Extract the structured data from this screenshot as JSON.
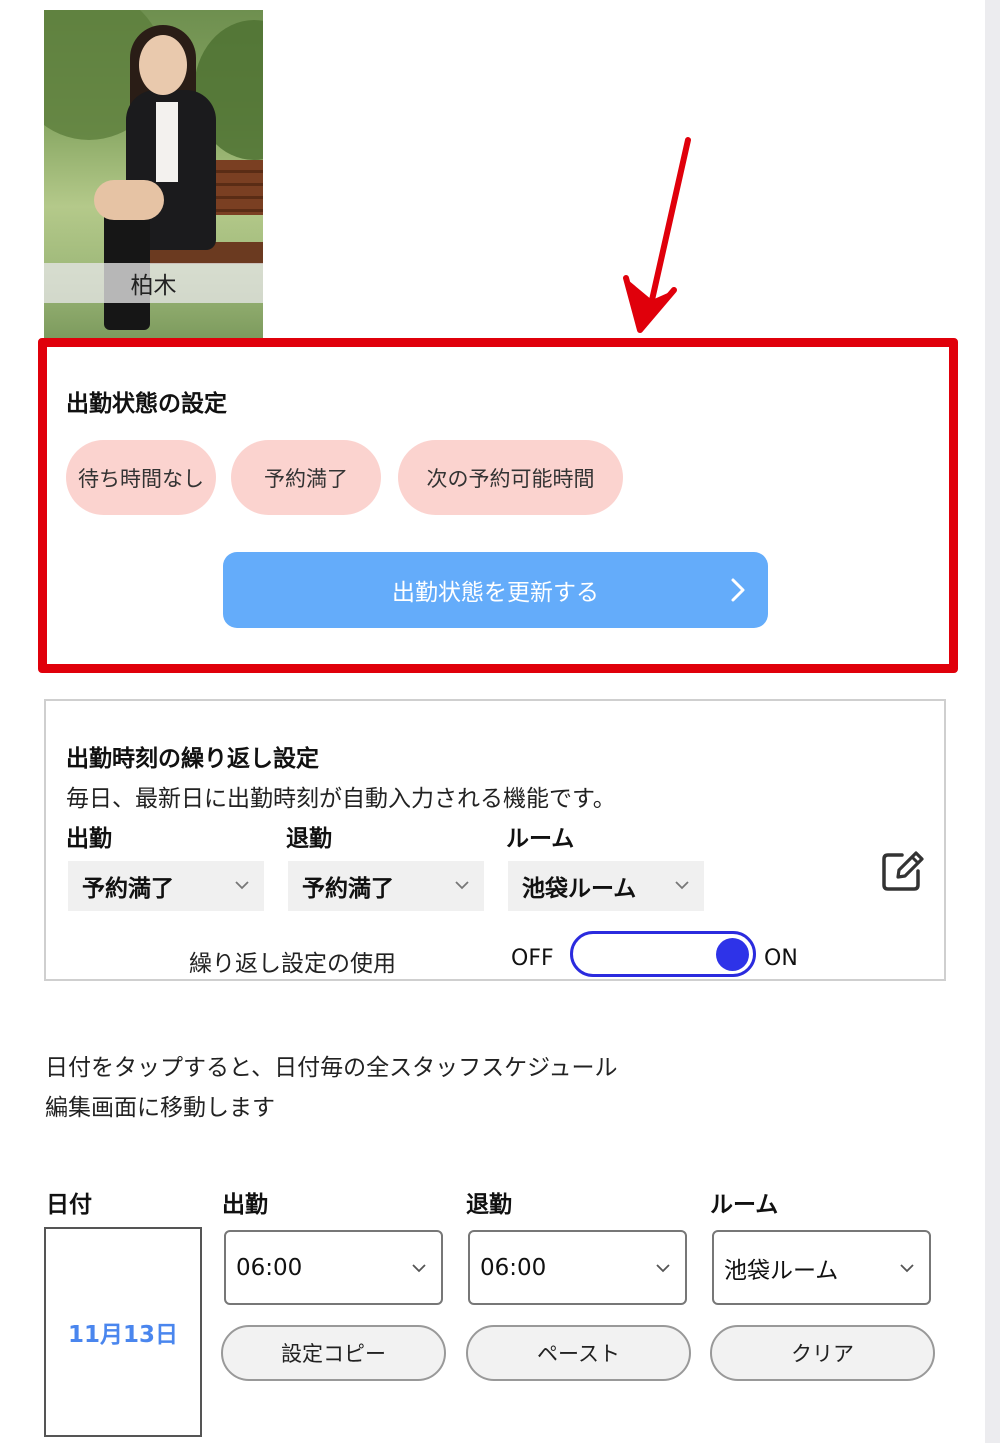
{
  "staff": {
    "name": "柏木"
  },
  "status_section": {
    "title": "出勤状態の設定",
    "options": [
      "待ち時間なし",
      "予約満了",
      "次の予約可能時間"
    ],
    "update_button": "出勤状態を更新する"
  },
  "repeat_section": {
    "title": "出勤時刻の繰り返し設定",
    "description": "毎日、最新日に出勤時刻が自動入力される機能です。",
    "start_label": "出勤",
    "end_label": "退勤",
    "room_label": "ルーム",
    "start_value": "予約満了",
    "end_value": "予約満了",
    "room_value": "池袋ルーム",
    "use_label": "繰り返し設定の使用",
    "toggle_off": "OFF",
    "toggle_on": "ON",
    "toggle_state": "ON"
  },
  "info": {
    "line1": "日付をタップすると、日付毎の全スタッフスケジュール",
    "line2": "編集画面に移動します"
  },
  "schedule": {
    "headers": {
      "date": "日付",
      "start": "出勤",
      "end": "退勤",
      "room": "ルーム"
    },
    "date": "11月13日",
    "start_time": "06:00",
    "end_time": "06:00",
    "room": "池袋ルーム",
    "copy_button": "設定コピー",
    "paste_button": "ペースト",
    "clear_button": "クリア"
  },
  "colors": {
    "highlight_border": "#e0000b",
    "pill_bg": "#fbd3cf",
    "primary_button": "#64acfa",
    "toggle": "#2e33e8",
    "date_text": "#4a86ee"
  }
}
